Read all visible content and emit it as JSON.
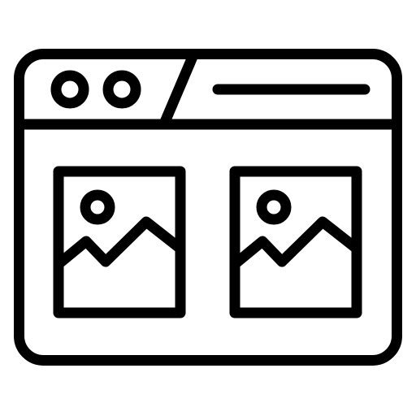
{
  "icon": {
    "name": "browser-window-image-gallery-icon",
    "stroke_color": "#000000",
    "background_color": "#ffffff",
    "window_controls": [
      "window-control-dot-1",
      "window-control-dot-2"
    ],
    "image_panels": [
      "image-placeholder-left",
      "image-placeholder-right"
    ]
  }
}
